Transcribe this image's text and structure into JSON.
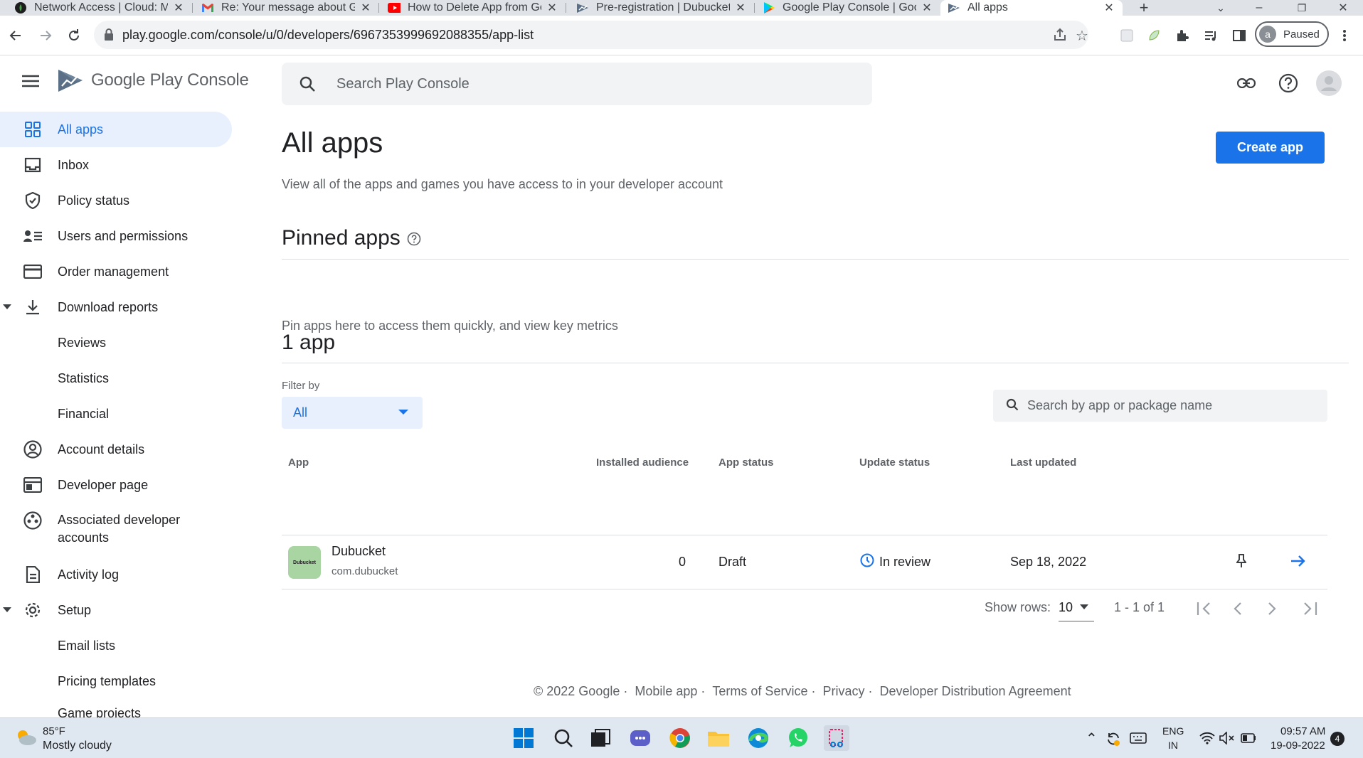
{
  "browser": {
    "tabs": [
      {
        "title": "Network Access | Cloud: Mo",
        "icon": "mongodb-leaf-icon",
        "active": false
      },
      {
        "title": "Re: Your message about Go",
        "icon": "gmail-icon",
        "active": false
      },
      {
        "title": "How to Delete App from Go",
        "icon": "youtube-icon",
        "active": false
      },
      {
        "title": "Pre-registration | Dubucket",
        "icon": "play-console-icon",
        "active": false
      },
      {
        "title": "Google Play Console | Goo",
        "icon": "google-play-icon",
        "active": false
      },
      {
        "title": "All apps",
        "icon": "play-console-icon",
        "active": true
      }
    ],
    "url": "play.google.com/console/u/0/developers/6967353999692088355/app-list",
    "profile_initial": "a",
    "profile_status": "Paused"
  },
  "header": {
    "brand": "Google Play",
    "brand_suffix": "Console",
    "search_placeholder": "Search Play Console"
  },
  "sidebar": {
    "items": [
      {
        "label": "All apps",
        "icon": "grid-icon",
        "selected": true
      },
      {
        "label": "Inbox",
        "icon": "inbox-icon"
      },
      {
        "label": "Policy status",
        "icon": "shield-check-icon"
      },
      {
        "label": "Users and permissions",
        "icon": "users-list-icon"
      },
      {
        "label": "Order management",
        "icon": "credit-card-icon"
      },
      {
        "label": "Download reports",
        "icon": "download-icon",
        "expanded": true
      },
      {
        "label": "Reviews",
        "sub": true
      },
      {
        "label": "Statistics",
        "sub": true
      },
      {
        "label": "Financial",
        "sub": true
      },
      {
        "label": "Account details",
        "icon": "account-circle-icon"
      },
      {
        "label": "Developer page",
        "icon": "web-page-icon"
      },
      {
        "label": "Associated developer",
        "label2": "accounts",
        "icon": "linked-accounts-icon"
      },
      {
        "label": "Activity log",
        "icon": "document-icon"
      },
      {
        "label": "Setup",
        "icon": "gear-icon",
        "expanded": true
      },
      {
        "label": "Email lists",
        "sub": true
      },
      {
        "label": "Pricing templates",
        "sub": true
      },
      {
        "label": "Game projects",
        "sub": true
      }
    ]
  },
  "main": {
    "title": "All apps",
    "subtitle": "View all of the apps and games you have access to in your developer account",
    "create_button": "Create app",
    "pinned_title": "Pinned apps",
    "pinned_subtitle": "Pin apps here to access them quickly, and view key metrics",
    "count_title": "1 app",
    "filter_label": "Filter by",
    "filter_value": "All",
    "table_search_placeholder": "Search by app or package name",
    "columns": [
      "App",
      "Installed audience",
      "App status",
      "Update status",
      "Last updated"
    ],
    "rows": [
      {
        "app_name": "Dubucket",
        "package": "com.dubucket",
        "icon_text": "Dubucket",
        "installed_audience": "0",
        "app_status": "Draft",
        "update_status": "In review",
        "last_updated": "Sep 18, 2022"
      }
    ],
    "pagination": {
      "show_rows_label": "Show rows:",
      "rows_per_page": "10",
      "range": "1 - 1 of 1"
    }
  },
  "footer": {
    "items": [
      "© 2022 Google",
      "Mobile app",
      "Terms of Service",
      "Privacy",
      "Developer Distribution Agreement"
    ]
  },
  "taskbar": {
    "weather_temp": "85°F",
    "weather_desc": "Mostly cloudy",
    "lang_top": "ENG",
    "lang_bottom": "IN",
    "time": "09:57 AM",
    "date": "19-09-2022",
    "notifications": "4"
  },
  "colors": {
    "accent": "#1a73e8",
    "selected_bg": "#e8f0fe"
  }
}
